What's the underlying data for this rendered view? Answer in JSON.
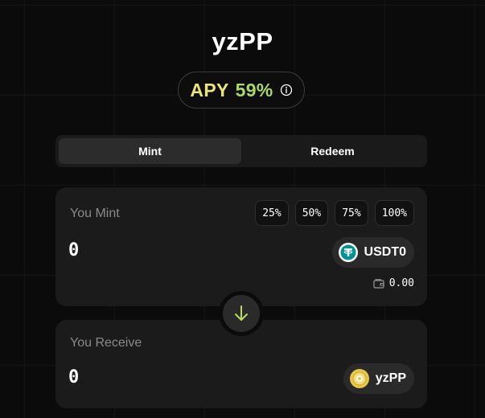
{
  "page": {
    "title": "yzPP"
  },
  "apy": {
    "label": "APY",
    "value": "59%",
    "icon": "info-icon",
    "label_color": "#e9e47a",
    "value_color": "#a8d86a"
  },
  "tabs": [
    {
      "label": "Mint",
      "active": true
    },
    {
      "label": "Redeem",
      "active": false
    }
  ],
  "mint_card": {
    "label": "You Mint",
    "percent_buttons": [
      "25%",
      "50%",
      "75%",
      "100%"
    ],
    "amount_placeholder": "0",
    "token": {
      "name": "USDT0",
      "icon": "usdt0-token-icon",
      "color": "#009393"
    },
    "balance": {
      "icon": "wallet-icon",
      "value": "0.00"
    }
  },
  "swap_arrow": {
    "icon": "arrow-down-icon",
    "color": "#b6dd5c"
  },
  "receive_card": {
    "label": "You Receive",
    "amount_placeholder": "0",
    "token": {
      "name": "yzPP",
      "icon": "yzpp-token-icon",
      "color": "#e7c64a"
    }
  }
}
